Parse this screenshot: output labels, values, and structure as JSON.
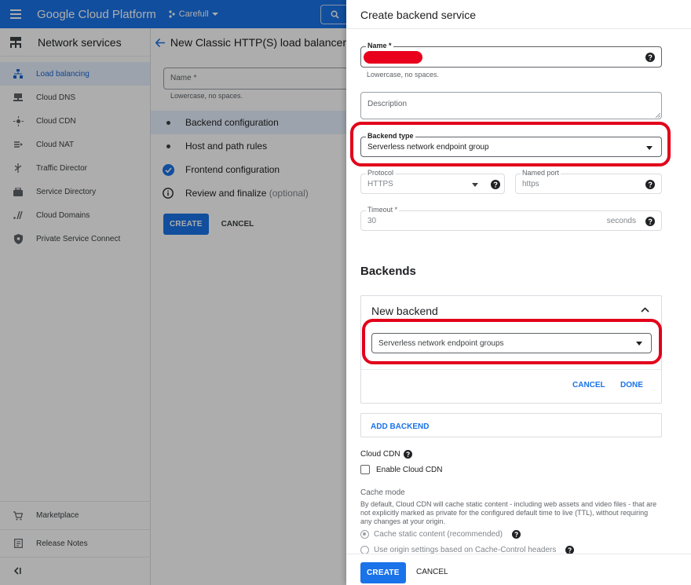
{
  "topbar": {
    "title": "Google Cloud Platform",
    "project": "Carefull"
  },
  "sidebar": {
    "header": "Network services",
    "items": [
      {
        "label": "Load balancing",
        "icon": "load-balancing-icon",
        "active": true
      },
      {
        "label": "Cloud DNS",
        "icon": "dns-icon"
      },
      {
        "label": "Cloud CDN",
        "icon": "cdn-icon"
      },
      {
        "label": "Cloud NAT",
        "icon": "nat-icon"
      },
      {
        "label": "Traffic Director",
        "icon": "traffic-director-icon"
      },
      {
        "label": "Service Directory",
        "icon": "service-directory-icon"
      },
      {
        "label": "Cloud Domains",
        "icon": "domains-icon"
      },
      {
        "label": "Private Service Connect",
        "icon": "shield-icon"
      }
    ],
    "bottom": [
      {
        "label": "Marketplace",
        "icon": "cart-icon"
      },
      {
        "label": "Release Notes",
        "icon": "notes-icon"
      }
    ]
  },
  "left_main": {
    "title": "New Classic HTTP(S) load balancer",
    "name_placeholder": "Name *",
    "name_hint": "Lowercase, no spaces.",
    "steps": [
      {
        "label": "Backend configuration",
        "state": "current"
      },
      {
        "label": "Host and path rules",
        "state": "pending"
      },
      {
        "label": "Frontend configuration",
        "state": "done"
      },
      {
        "label": "Review and finalize",
        "optional": "(optional)",
        "state": "info"
      }
    ],
    "create_label": "CREATE",
    "cancel_label": "CANCEL"
  },
  "panel": {
    "title": "Create backend service",
    "name_label": "Name",
    "name_required": "*",
    "name_hint": "Lowercase, no spaces.",
    "description_placeholder": "Description",
    "backend_type_label": "Backend type",
    "backend_type_value": "Serverless network endpoint group",
    "protocol_label": "Protocol",
    "protocol_value": "HTTPS",
    "named_port_label": "Named port",
    "named_port_value": "https",
    "timeout_label": "Timeout *",
    "timeout_value": "30",
    "timeout_unit": "seconds",
    "backends_title": "Backends",
    "new_backend_title": "New backend",
    "backend_select_value": "Serverless network endpoint groups",
    "backend_cancel": "CANCEL",
    "backend_done": "DONE",
    "add_backend": "ADD BACKEND",
    "cloud_cdn_label": "Cloud CDN",
    "enable_cdn_label": "Enable Cloud CDN",
    "cache_mode_label": "Cache mode",
    "cache_mode_desc": "By default, Cloud CDN will cache static content - including web assets and video files - that are not explicitly marked as private for the configured default time to live (TTL), without requiring any changes at your origin.",
    "cache_option_1": "Cache static content (recommended)",
    "cache_option_2": "Use origin settings based on Cache-Control headers",
    "create_label": "CREATE",
    "cancel_label": "CANCEL"
  },
  "colors": {
    "accent": "#1a73e8",
    "annotation_red": "#e2001a"
  }
}
